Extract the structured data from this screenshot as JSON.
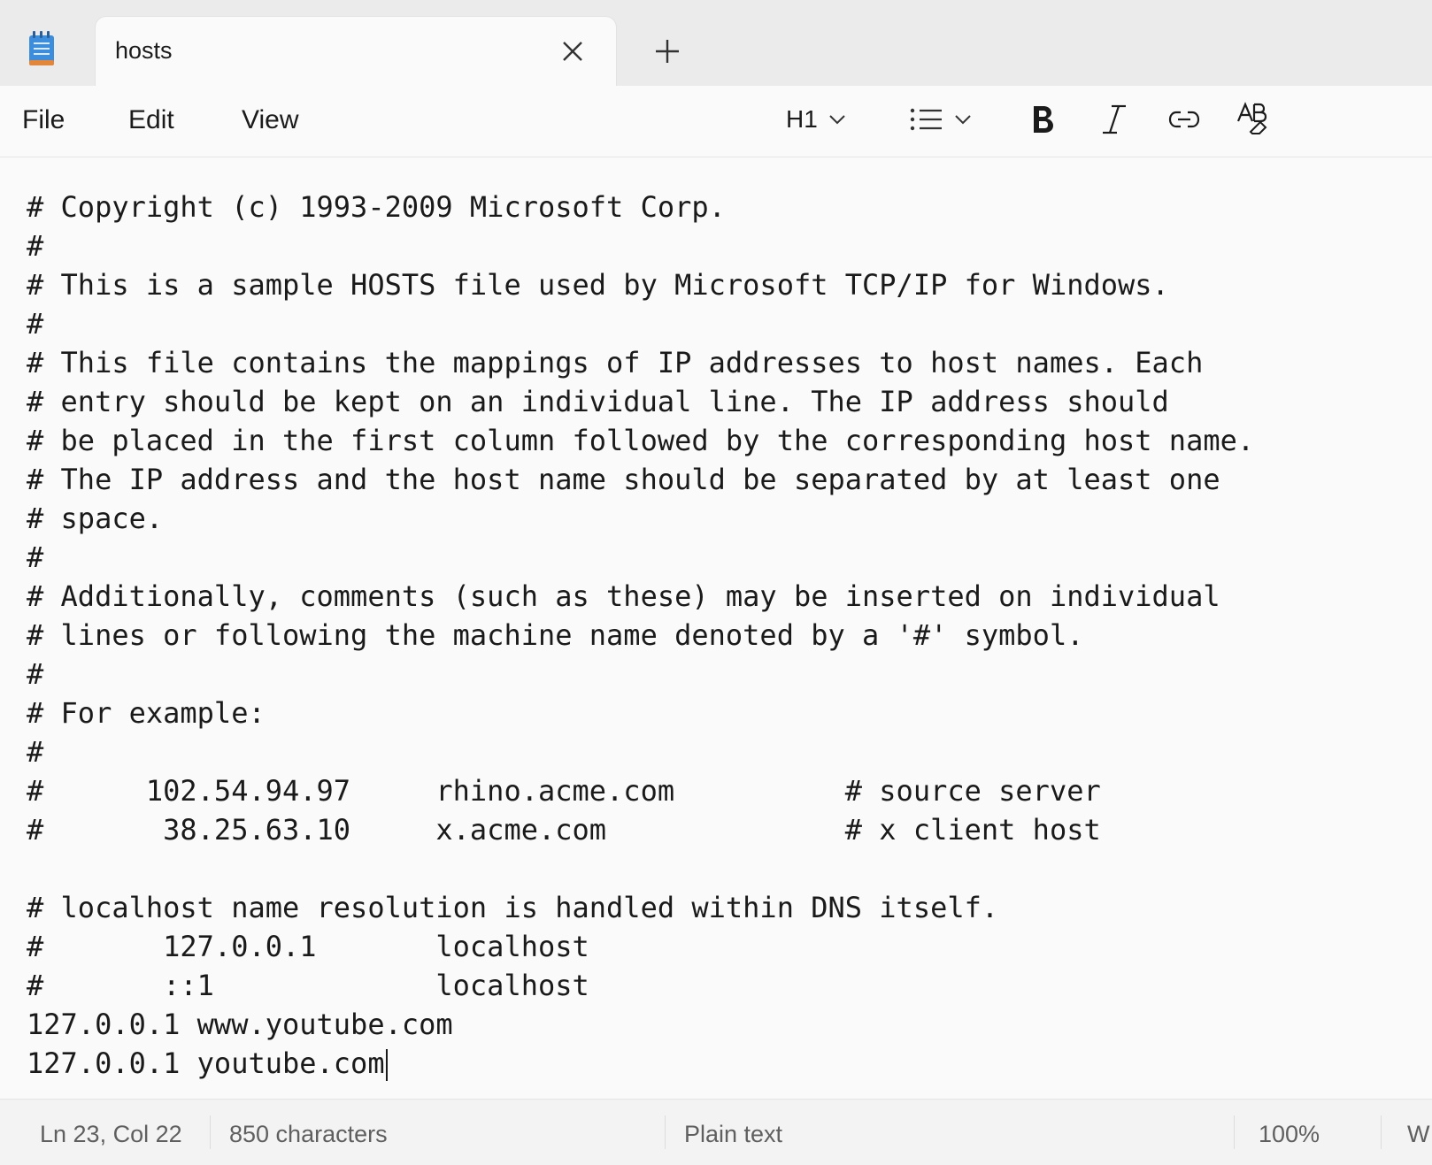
{
  "tab": {
    "title": "hosts",
    "close_icon": "close-icon",
    "new_tab_icon": "plus-icon"
  },
  "menu": {
    "file": "File",
    "edit": "Edit",
    "view": "View"
  },
  "toolbar": {
    "heading": "H1",
    "list_icon": "bulleted-list-icon",
    "bold_icon": "bold-icon",
    "italic_icon": "italic-icon",
    "link_icon": "link-icon",
    "clear_format_icon": "clear-formatting-icon"
  },
  "editor": {
    "lines": [
      "# Copyright (c) 1993-2009 Microsoft Corp.",
      "#",
      "# This is a sample HOSTS file used by Microsoft TCP/IP for Windows.",
      "#",
      "# This file contains the mappings of IP addresses to host names. Each",
      "# entry should be kept on an individual line. The IP address should",
      "# be placed in the first column followed by the corresponding host name.",
      "# The IP address and the host name should be separated by at least one",
      "# space.",
      "#",
      "# Additionally, comments (such as these) may be inserted on individual",
      "# lines or following the machine name denoted by a '#' symbol.",
      "#",
      "# For example:",
      "#",
      "#      102.54.94.97     rhino.acme.com          # source server",
      "#       38.25.63.10     x.acme.com              # x client host",
      "",
      "# localhost name resolution is handled within DNS itself.",
      "#       127.0.0.1       localhost",
      "#       ::1             localhost",
      "127.0.0.1 www.youtube.com",
      "127.0.0.1 youtube.com"
    ]
  },
  "status": {
    "position": "Ln 23, Col 22",
    "characters": "850 characters",
    "format": "Plain text",
    "zoom": "100%",
    "line_ending_partial": "W"
  }
}
